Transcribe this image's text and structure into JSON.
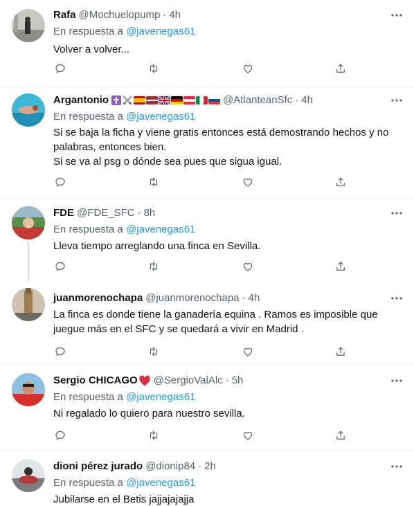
{
  "tweets": [
    {
      "name": "Rafa",
      "handle": "@Mochuelopump",
      "time": "4h",
      "reply_prefix": "En respuesta a",
      "reply_to": "@javenegas61",
      "lines": [
        "Volver a volver..."
      ]
    },
    {
      "name": "Argantonio",
      "handle": "@AtlanteanSfc",
      "time": "4h",
      "reply_prefix": "En respuesta a",
      "reply_to": "@javenegas61",
      "lines": [
        "Si se baja la ficha y viene gratis entonces está demostrando hechos y no",
        "palabras, entonces bien.",
        "Si se va al psg o dónde sea pues que sigua igual."
      ]
    },
    {
      "name": "FDE",
      "handle": "@FDE_SFC",
      "time": "8h",
      "reply_prefix": "En respuesta a",
      "reply_to": "@javenegas61",
      "lines": [
        "Lleva tiempo arreglando una finca en Sevilla."
      ]
    },
    {
      "name": "juanmorenochapa",
      "handle": "@juanmorenochapa",
      "time": "4h",
      "lines": [
        "La finca es donde tiene la ganadería equina . Ramos es imposible que",
        "juegue más en el SFC y se quedará a vivir en Madrid ."
      ]
    },
    {
      "name": "Sergio CHICAGO",
      "handle": "@SergioValAlc",
      "time": "5h",
      "reply_prefix": "En respuesta a",
      "reply_to": "@javenegas61",
      "lines": [
        "Ni regalado lo quiero para nuestro sevilla."
      ]
    },
    {
      "name": "dioni pérez jurado",
      "handle": "@dionip84",
      "time": "2h",
      "reply_prefix": "En respuesta a",
      "reply_to": "@javenegas61",
      "lines": [
        "Jubilarse en el  Betis jajjajajajja"
      ]
    }
  ],
  "separator": "·",
  "icons": {
    "more": "more-horizontal-icon",
    "reply": "reply-bubble-icon",
    "retweet": "retweet-arrows-icon",
    "like": "heart-icon",
    "share": "share-upload-icon"
  },
  "colors": {
    "text": "#0f1419",
    "secondary": "#536471",
    "accent": "#1d9bf0",
    "divider": "#eff3f4",
    "thread_line": "#cfd9de"
  }
}
